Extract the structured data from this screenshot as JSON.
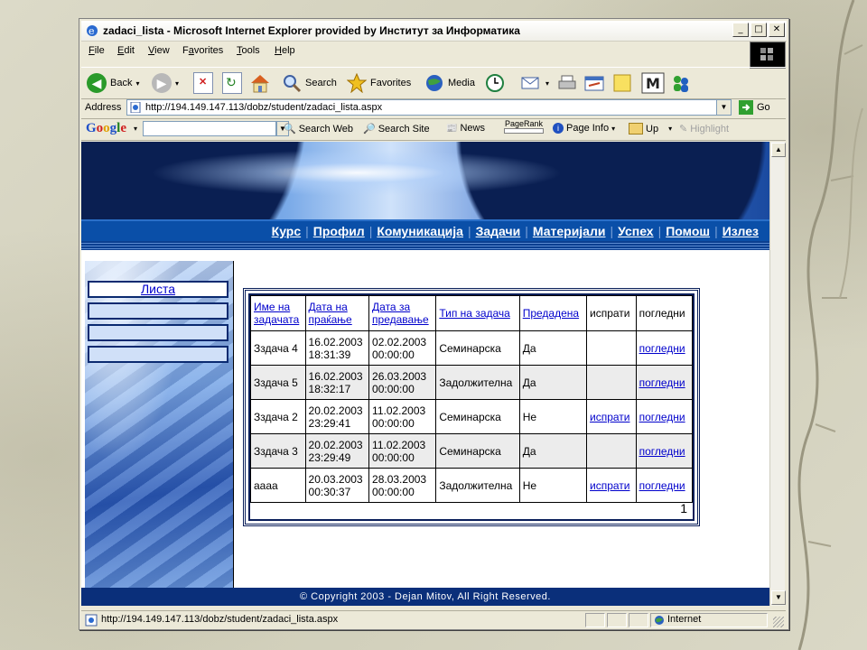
{
  "window": {
    "title": "zadaci_lista - Microsoft Internet Explorer provided by Институт за Информатика"
  },
  "window_controls": {
    "minimize": "_",
    "maximize": "□",
    "close": "✕"
  },
  "menu": [
    {
      "label": "File",
      "key": "F"
    },
    {
      "label": "Edit",
      "key": "E"
    },
    {
      "label": "View",
      "key": "V"
    },
    {
      "label": "Favorites",
      "key": "a"
    },
    {
      "label": "Tools",
      "key": "T"
    },
    {
      "label": "Help",
      "key": "H"
    }
  ],
  "toolbar": {
    "back": "Back",
    "search": "Search",
    "favorites": "Favorites",
    "media": "Media"
  },
  "address": {
    "label": "Address",
    "url": "http://194.149.147.113/dobz/student/zadaci_lista.aspx",
    "go": "Go"
  },
  "googlebar": {
    "logo": [
      "G",
      "o",
      "o",
      "g",
      "l",
      "e"
    ],
    "search_web": "Search Web",
    "search_site": "Search Site",
    "news": "News",
    "pagerank": "PageRank",
    "page_info": "Page Info",
    "up": "Up",
    "highlight": "Highlight"
  },
  "site_nav": [
    "Курс",
    "Профил",
    "Комуникација",
    "Задачи",
    "Материјали",
    "Успех",
    "Помош",
    "Излез"
  ],
  "left_menu": {
    "first": "Листа"
  },
  "table": {
    "headers": [
      "Име на задачата",
      "Дата на праќање",
      "Дата за предавање",
      "Тип на задача",
      "Предадена",
      "испрати",
      "погледни"
    ],
    "rows": [
      [
        "Зздача 4",
        "16.02.2003 18:31:39",
        "02.02.2003 00:00:00",
        "Семинарска",
        "Да",
        "",
        "погледни"
      ],
      [
        "Зздача 5",
        "16.02.2003 18:32:17",
        "26.03.2003 00:00:00",
        "Задолжителна",
        "Да",
        "",
        "погледни"
      ],
      [
        "Зздача 2",
        "20.02.2003 23:29:41",
        "11.02.2003 00:00:00",
        "Семинарска",
        "Не",
        "испрати",
        "погледни"
      ],
      [
        "Зздача 3",
        "20.02.2003 23:29:49",
        "11.02.2003 00:00:00",
        "Семинарска",
        "Да",
        "",
        "погледни"
      ],
      [
        "аааа",
        "20.03.2003 00:30:37",
        "28.03.2003 00:00:00",
        "Задолжителна",
        "Не",
        "испрати",
        "погледни"
      ]
    ],
    "pager": "1"
  },
  "footer": {
    "copyright": "© Copyright 2003 - Dejan Mitov, All Right Reserved."
  },
  "status": {
    "url": "http://194.149.147.113/dobz/student/zadaci_lista.aspx",
    "zone": "Internet"
  },
  "colors": {
    "nav_blue": "#0a4fa8",
    "footer_dark": "#0a2f7a",
    "link": "#0000cc"
  }
}
